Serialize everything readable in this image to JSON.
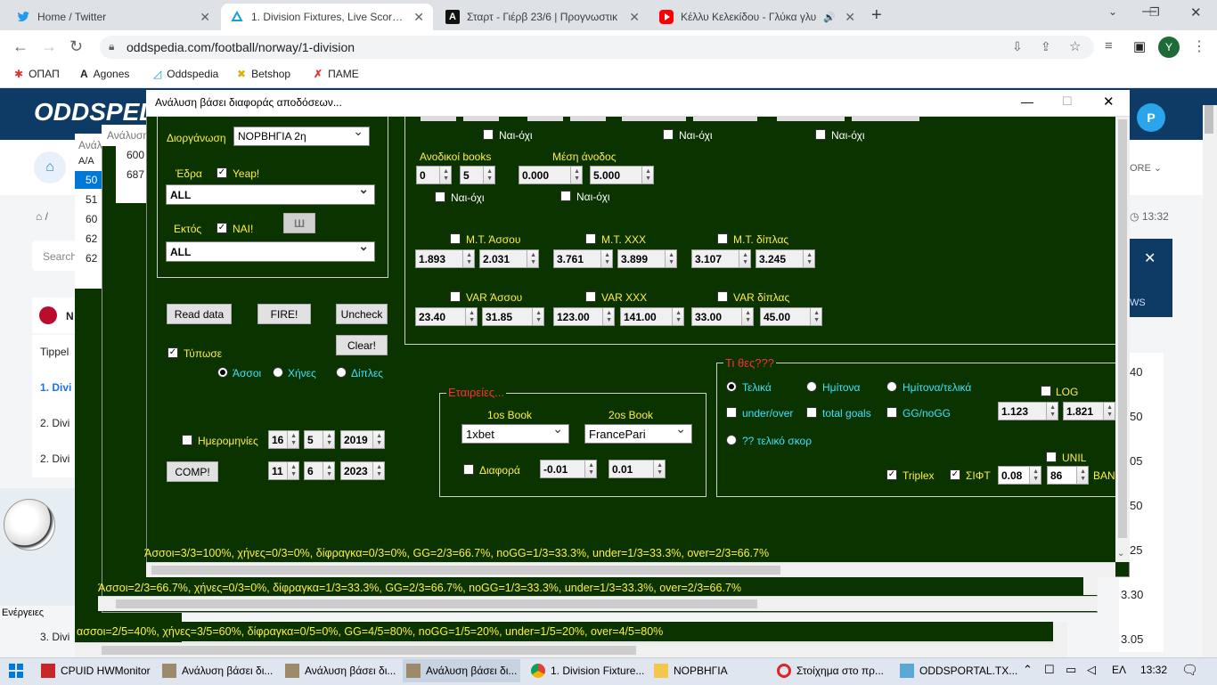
{
  "browser": {
    "tabs": [
      {
        "title": "Home / Twitter",
        "favicon": "twitter-icon"
      },
      {
        "title": "1. Division Fixtures, Live Scores &",
        "favicon": "oddspedia-icon",
        "active": true
      },
      {
        "title": "Σταρτ - Γιέρβ 23/6 | Προγνωστικ",
        "favicon": "agones-icon"
      },
      {
        "title": "Κέλλυ Κελεκίδου - Γλύκα γλυ",
        "favicon": "youtube-icon",
        "audio": true
      }
    ],
    "new_tab": "+",
    "url": "oddspedia.com/football/norway/1-division",
    "profile_initial": "Y",
    "bookmarks": [
      "ΟΠΑΠ",
      "Agones",
      "Oddspedia",
      "Betshop",
      "ΠΑΜΕ"
    ]
  },
  "webpage": {
    "logo": "ODDSPEDIA",
    "profile_badge": "P",
    "more_label": "ORE",
    "time": "13:32",
    "search_placeholder": "Search",
    "country_initial": "N",
    "news_label": "WS",
    "list_items": [
      "Tippel",
      "1. Divi",
      "2. Divi",
      "2. Divi",
      "3. Divi"
    ],
    "odds": [
      "40",
      "50",
      "05",
      "50",
      "25",
      "3.30",
      "3.05"
    ],
    "promo_label": "Ενέργειες"
  },
  "back_window": {
    "title": "Ανάλυ",
    "col_header": "Α/Α",
    "rows": [
      "50",
      "51",
      "60",
      "62",
      "62"
    ],
    "status": "ασσοι=2/5=40%, χήνες=3/5=60%, δίφραγκα=0/5=0%, GG=4/5=80%, noGG=1/5=20%, under=1/5=20%, over=4/5=80%"
  },
  "mid_window": {
    "title": "Ανάλυση",
    "rows": [
      "600",
      "687"
    ],
    "status": "Άσσοι=2/3=66.7%, χήνες=0/3=0%, δίφραγκα=1/3=33.3%, GG=2/3=66.7%, noGG=1/3=33.3%, under=1/3=33.3%, over=2/3=66.7%"
  },
  "dialog": {
    "title": "Ανάλυση βάσει διαφοράς αποδόσεων...",
    "competition_label": "Διοργάνωση",
    "competition_value": "ΝΟΡΒΗΓΙΑ 2η",
    "home_label": "Έδρα",
    "home_check_label": "Yeap!",
    "home_select": "ALL",
    "away_label": "Εκτός",
    "away_check_label": "NAI!",
    "w_button": "Ш",
    "away_select": "ALL",
    "buttons": {
      "read": "Read data",
      "fire": "FIRE!",
      "uncheck": "Uncheck",
      "clear": "Clear!",
      "comp": "COMP!"
    },
    "print_label": "Τύπωσε",
    "print_options": [
      "Άσσοι",
      "Χήνες",
      "Δίπλες"
    ],
    "dates_label": "Ημερομηνίες",
    "date_from": {
      "day": "16",
      "month": "5",
      "year": "2019"
    },
    "date_to": {
      "day": "11",
      "month": "6",
      "year": "2023"
    },
    "yesno": "Ναι-όχι",
    "rising_books_label": "Ανοδικοί books",
    "rising_books": [
      "0",
      "5"
    ],
    "avg_rise_label": "Μέση άνοδος",
    "avg_rise": [
      "0.000",
      "5.000"
    ],
    "avg_labels": [
      "Μ.Τ. Άσσου",
      "Μ.Τ. XXX",
      "Μ.Τ. δίπλας"
    ],
    "avg_values": [
      "1.893",
      "2.031",
      "3.761",
      "3.899",
      "3.107",
      "3.245"
    ],
    "var_labels": [
      "VAR Άσσου",
      "VAR XXX",
      "VAR δίπλας"
    ],
    "var_values": [
      "23.40",
      "31.85",
      "123.00",
      "141.00",
      "33.00",
      "45.00"
    ],
    "companies_title": "Εταιρείες...",
    "book1_label": "1os Book",
    "book1": "1xbet",
    "book2_label": "2os Book",
    "book2": "FrancePari",
    "diff_label": "Διαφορά",
    "diff_values": [
      "-0.01",
      "0.01"
    ],
    "bets_title": "Τι θες???",
    "bet_options": [
      "Τελικά",
      "Ημίτονα",
      "Ημίτονα/τελικά",
      "under/over",
      "total goals",
      "GG/noGG",
      "?? τελικό σκορ"
    ],
    "log_label": "LOG",
    "log_values": [
      "1.123",
      "1.821"
    ],
    "unil_label": "UNIL",
    "triplex_label": "Triplex",
    "sift_label": "ΣΙΦΤ",
    "sift_values": [
      "0.08",
      "86"
    ],
    "ban_label": "BAN",
    "status": "Άσσοι=3/3=100%, χήνες=0/3=0%, δίφραγκα=0/3=0%, GG=2/3=66.7%, noGG=1/3=33.3%, under=1/3=33.3%, over=2/3=66.7%"
  },
  "taskbar": {
    "items": [
      {
        "label": "CPUID HWMonitor",
        "icon": "hwmonitor-icon"
      },
      {
        "label": "Ανάλυση βάσει δι...",
        "icon": "app-icon"
      },
      {
        "label": "Ανάλυση βάσει δι...",
        "icon": "app-icon"
      },
      {
        "label": "Ανάλυση βάσει δι...",
        "icon": "app-icon"
      },
      {
        "label": "1. Division Fixture...",
        "icon": "chrome-icon"
      },
      {
        "label": "ΝΟΡΒΗΓΙΑ",
        "icon": "folder-icon"
      },
      {
        "label": "Στοίχημα στο πρ...",
        "icon": "opera-icon"
      },
      {
        "label": "ODDSPORTAL.TX...",
        "icon": "notepad-icon"
      }
    ],
    "lang": "ΕΛ",
    "time": "13:32"
  },
  "colors": {
    "panel": "#0a3300",
    "label": "#ffef40",
    "accent": "#3fe0ff",
    "title_red": "#ff3030"
  }
}
